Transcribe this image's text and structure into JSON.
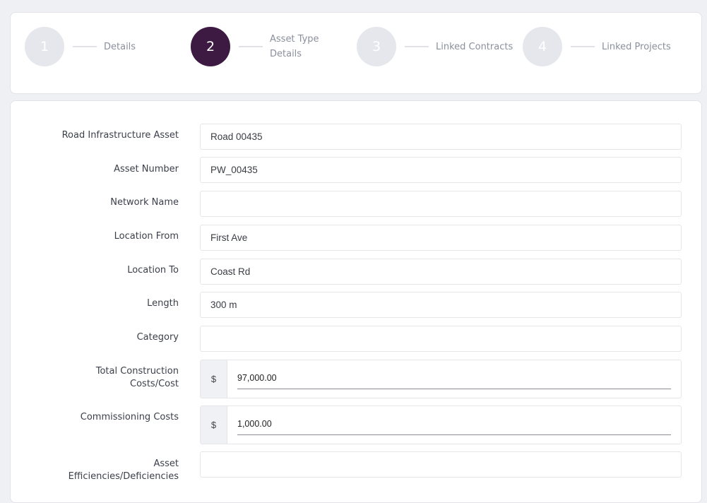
{
  "stepper": {
    "steps": [
      {
        "number": "1",
        "label": "Details"
      },
      {
        "number": "2",
        "label": "Asset Type Details"
      },
      {
        "number": "3",
        "label": "Linked Contracts"
      },
      {
        "number": "4",
        "label": "Linked Projects"
      }
    ],
    "active_step": 2,
    "active_color": "#3d1a42",
    "inactive_color": "#e5e7ec"
  },
  "form": {
    "fields": [
      {
        "label": "Road Infrastructure Asset",
        "value": "Road 00435"
      },
      {
        "label": "Asset Number",
        "value": "PW_00435"
      },
      {
        "label": "Network Name",
        "value": ""
      },
      {
        "label": "Location From",
        "value": "First Ave"
      },
      {
        "label": "Location To",
        "value": "Coast Rd"
      },
      {
        "label": "Length",
        "value": "300 m"
      },
      {
        "label": "Category",
        "value": ""
      },
      {
        "label": "Total Construction Costs/Cost",
        "prefix": "$",
        "value": "97,000.00"
      },
      {
        "label": "Commissioning Costs",
        "prefix": "$",
        "value": "1,000.00"
      },
      {
        "label": "Asset Efficiencies/Deficiencies",
        "value": ""
      }
    ]
  }
}
